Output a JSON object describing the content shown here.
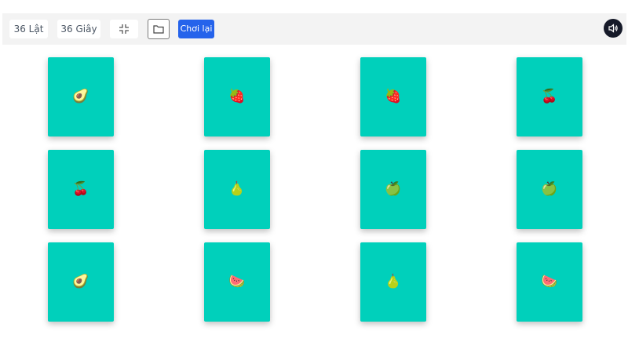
{
  "toolbar": {
    "flips_label": "36 Lật",
    "time_label": "36 Giây",
    "fullscreen_icon": "exit-fullscreen-icon",
    "folder_icon": "folder-icon",
    "restart_label": "Chơi lại",
    "sound_icon": "speaker-icon"
  },
  "colors": {
    "card": "#00d0bb",
    "restart_button": "#2563eb",
    "sound_button": "#161a29",
    "toolbar": "#f3f3f3"
  },
  "board": {
    "rows": [
      [
        "🥑",
        "🍓",
        "🍓",
        "🍒"
      ],
      [
        "🍒",
        "🍐",
        "🍏",
        "🍏"
      ],
      [
        "🥑",
        "🍉",
        "🍐",
        "🍉"
      ]
    ],
    "card_names": [
      [
        "avocado",
        "strawberry",
        "strawberry",
        "cherry"
      ],
      [
        "cherry",
        "pear",
        "green-apple",
        "green-apple"
      ],
      [
        "avocado",
        "watermelon",
        "pear",
        "watermelon"
      ]
    ]
  }
}
